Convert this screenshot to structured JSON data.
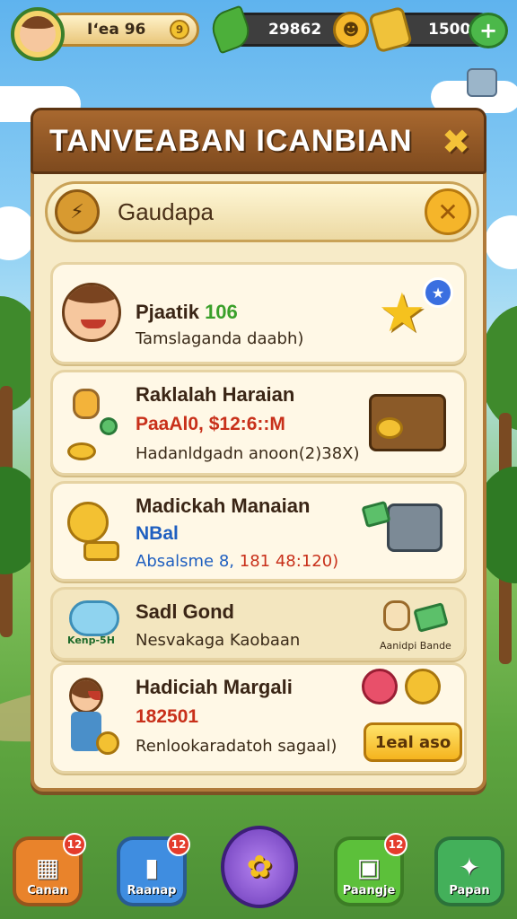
{
  "topbar": {
    "player_name": "Iʻea 96",
    "gems": "29862",
    "gold": "1500",
    "plus_label": "+"
  },
  "modal": {
    "title": "TANVEABAN ICANBIAN",
    "section_label": "Gaudapa"
  },
  "cards": [
    {
      "title": "Pjaatik",
      "title_value": "106",
      "line2": "",
      "line3": "Tamslaganda daabh)"
    },
    {
      "title": "Raklalah Haraian",
      "line2": "PaaAl0, $12:6::M",
      "line3": "Hadanldgadn anoon(2)38X)"
    },
    {
      "title": "Madickah Manaian",
      "line2": "NBal",
      "line3_a": "Absalsme 8,",
      "line3_b": "181 48:120)"
    },
    {
      "title": "Sadl Gond",
      "line2": "",
      "line3": "Nesvakaga Kaobaan",
      "side_label": "Aanidpi Bande"
    },
    {
      "title": "Hadiciah Margali",
      "line2": "182501",
      "line3": "Renlookaradatoh sagaal)",
      "button": "1eal aso"
    }
  ],
  "cloud_icon_label": "Kenp-5H",
  "bottom_nav": [
    {
      "label": "Canan",
      "badge": "12",
      "color": "#e9832b"
    },
    {
      "label": "Raanap",
      "badge": "12",
      "color": "#3f8de0"
    },
    {
      "label": "",
      "badge": "",
      "color": "#8b55d6"
    },
    {
      "label": "Paangje",
      "badge": "12",
      "color": "#5cc03a"
    },
    {
      "label": "Papan",
      "badge": "",
      "color": "#43b05a"
    }
  ]
}
